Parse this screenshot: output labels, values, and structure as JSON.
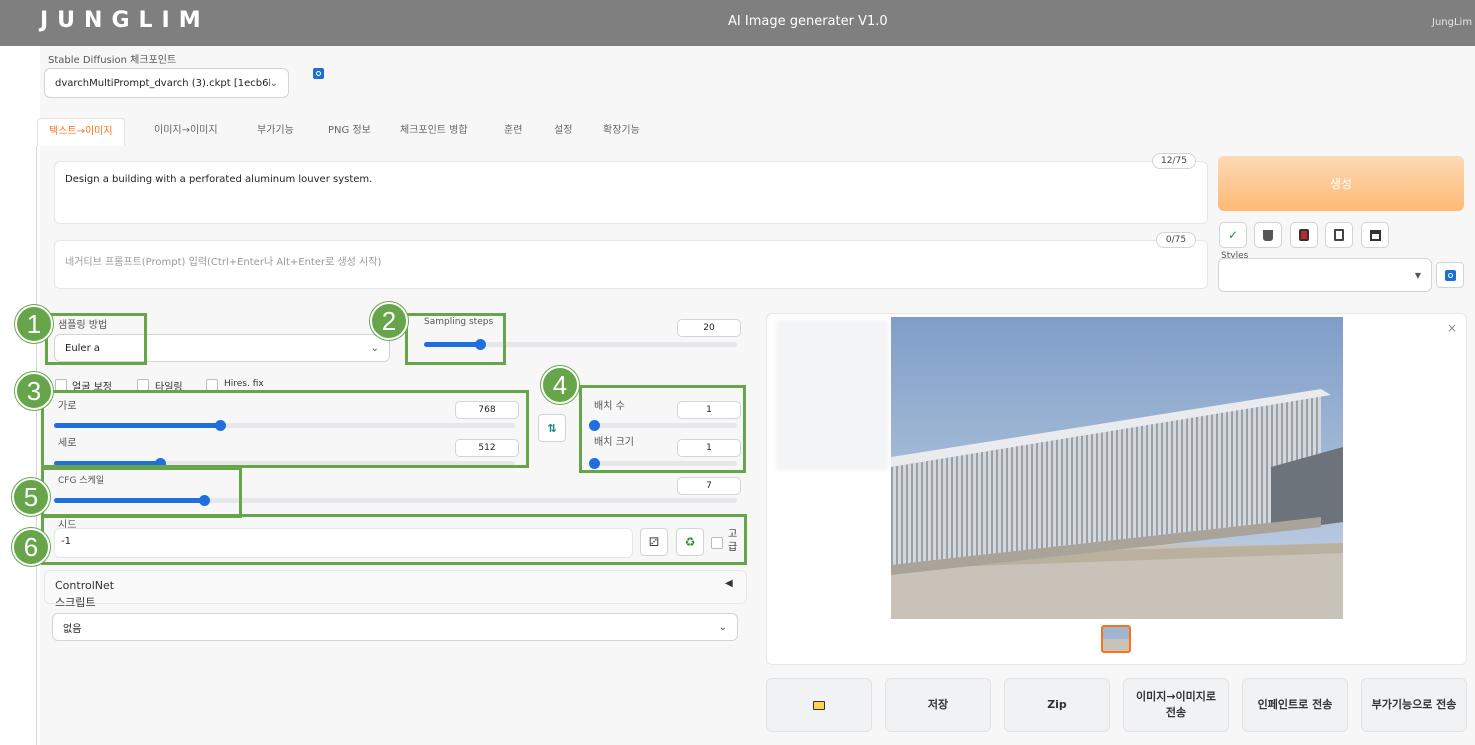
{
  "header": {
    "logo": "JUNGLIM",
    "app_title": "AI Image generater V1.0",
    "user": "JungLim"
  },
  "checkpoint": {
    "label": "Stable Diffusion 체크포인트",
    "value": "dvarchMultiPrompt_dvarch (3).ckpt [1ecb6b4"
  },
  "tabs": [
    "텍스트→이미지",
    "이미지→이미지",
    "부가기능",
    "PNG 정보",
    "체크포인트 병합",
    "훈련",
    "설정",
    "확장기능"
  ],
  "prompt": {
    "value": "Design a building with a perforated aluminum louver system.",
    "counter": "12/75"
  },
  "negative_prompt": {
    "placeholder": "네거티브 프롬프트(Prompt) 입력(Ctrl+Enter나 Alt+Enter로 생성 시작)",
    "counter": "0/75"
  },
  "generate_label": "생성",
  "toolbar_icons": [
    "check-icon",
    "trash-icon",
    "red-card-icon",
    "clipboard-icon",
    "save-icon"
  ],
  "styles_label": "Styles",
  "sampler": {
    "label": "샘플링 방법",
    "value": "Euler a"
  },
  "sampling_steps": {
    "label": "Sampling steps",
    "value": "20",
    "fraction": 0.18
  },
  "checkboxes": [
    {
      "label": "얼굴 보정"
    },
    {
      "label": "타일링"
    },
    {
      "label": "Hires. fix"
    }
  ],
  "width": {
    "label": "가로",
    "value": "768",
    "fraction": 0.36
  },
  "height": {
    "label": "세로",
    "value": "512",
    "fraction": 0.23
  },
  "batch_count": {
    "label": "배치 수",
    "value": "1",
    "fraction": 0.0
  },
  "batch_size": {
    "label": "배치 크기",
    "value": "1",
    "fraction": 0.0
  },
  "cfg": {
    "label": "CFG 스케일",
    "value": "7",
    "fraction": 0.22
  },
  "seed": {
    "label": "시드",
    "value": "-1",
    "extra_label": "고급"
  },
  "controlnet_label": "ControlNet",
  "script": {
    "label": "스크립트",
    "value": "없음"
  },
  "annotations": [
    "1",
    "2",
    "3",
    "4",
    "5",
    "6"
  ],
  "output_buttons": [
    "저장",
    "Zip",
    "이미지→이미지로 전송",
    "인페인트로 전송",
    "부가기능으로 전송"
  ],
  "colors": {
    "accent": "#f97316",
    "slider": "#1f6fe0",
    "annotation": "#66a549",
    "topbar": "#7f7f7f"
  }
}
